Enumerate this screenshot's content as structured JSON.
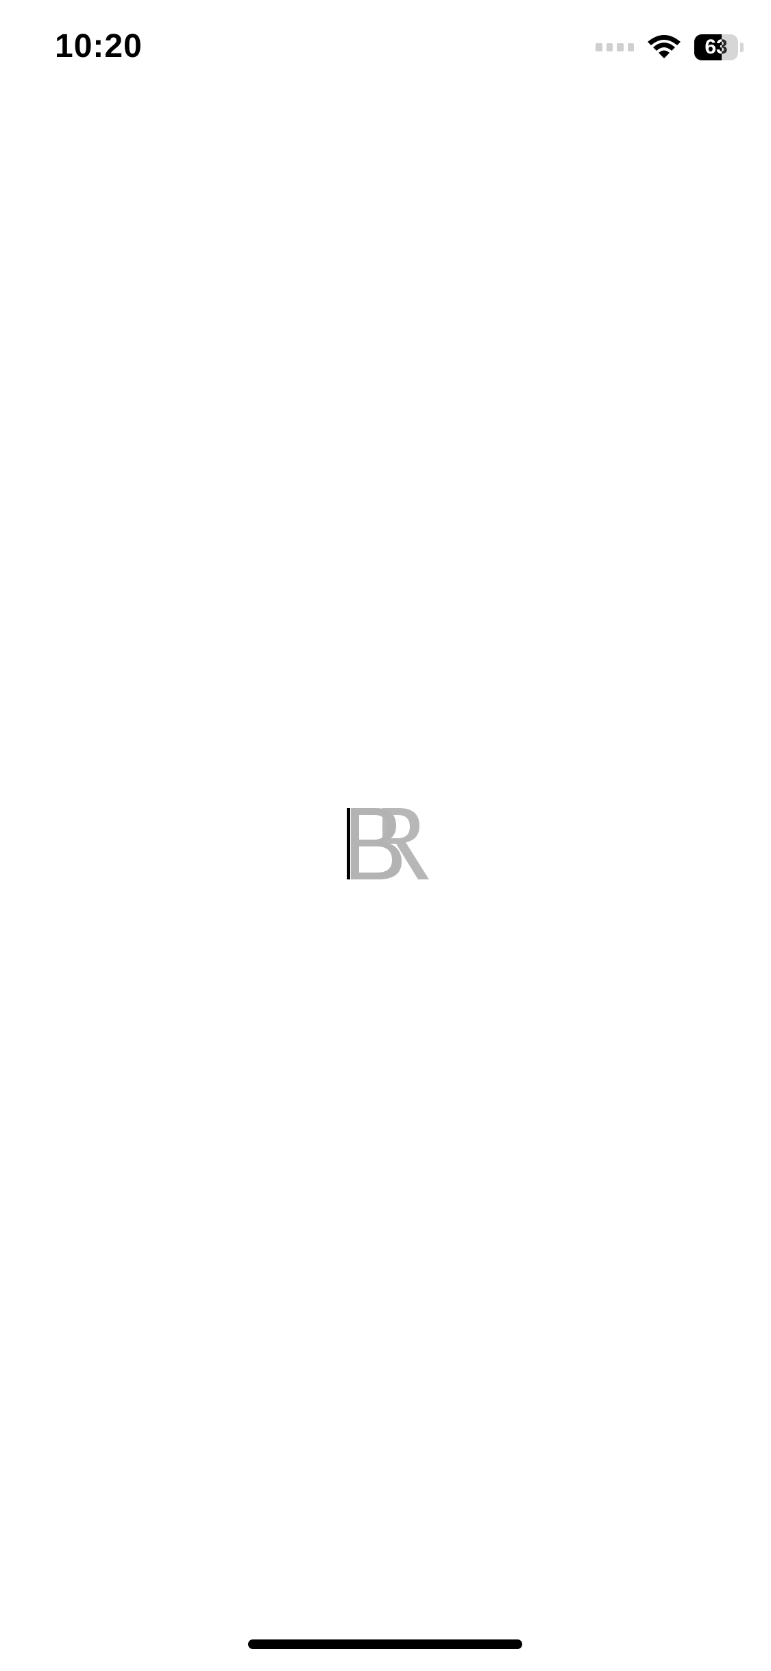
{
  "status_bar": {
    "time": "10:20",
    "battery_level": "63",
    "battery_fraction": 0.63,
    "icons": [
      "signal-icon",
      "wifi-icon",
      "battery-icon"
    ]
  },
  "logo": {
    "letters": "BR",
    "colors": {
      "accent": "#000000",
      "mark": "#b3b3b3"
    }
  },
  "home_indicator": {
    "icon": "home-indicator"
  }
}
